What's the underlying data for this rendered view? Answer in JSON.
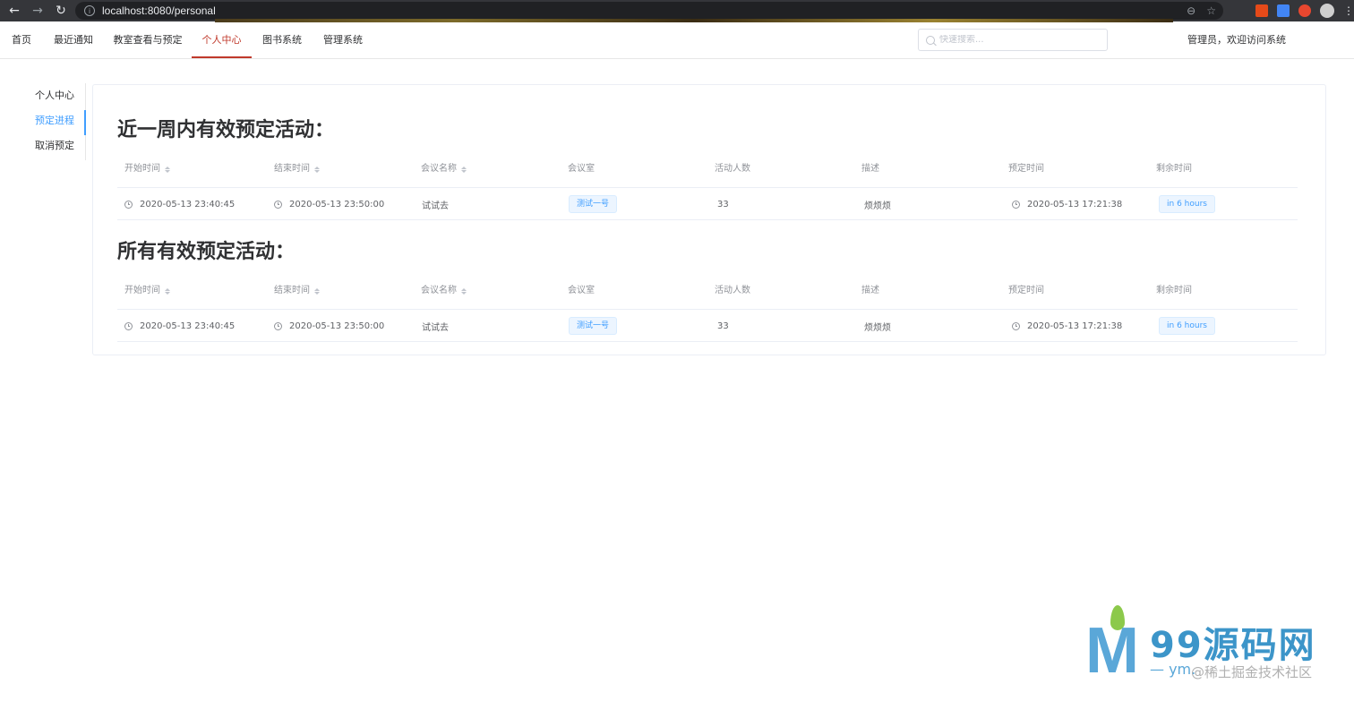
{
  "browser": {
    "url": "localhost:8080/personal",
    "back_icon": "arrow-left-icon",
    "forward_icon": "arrow-right-icon",
    "reload_icon": "reload-icon"
  },
  "top_menu": {
    "items": [
      "首页",
      "最近通知",
      "教室查看与预定",
      "个人中心",
      "图书系统",
      "管理系统"
    ],
    "active_index": 3,
    "search_placeholder": "快速搜索...",
    "welcome": "管理员，欢迎访问系统"
  },
  "side_menu": {
    "items": [
      "个人中心",
      "预定进程",
      "取消预定"
    ],
    "active_index": 1
  },
  "sections": [
    {
      "title": "近一周内有效预定活动：",
      "columns": [
        "开始时间",
        "结束时间",
        "会议名称",
        "会议室",
        "活动人数",
        "描述",
        "预定时间",
        "剩余时间"
      ],
      "rows": [
        {
          "start": "2020-05-13 23:40:45",
          "end": "2020-05-13 23:50:00",
          "name": "试试去",
          "room": "测试一号",
          "people": "33",
          "desc": "烦烦烦",
          "booked": "2020-05-13 17:21:38",
          "remaining": "in 6 hours"
        }
      ]
    },
    {
      "title": "所有有效预定活动：",
      "columns": [
        "开始时间",
        "结束时间",
        "会议名称",
        "会议室",
        "活动人数",
        "描述",
        "预定时间",
        "剩余时间"
      ],
      "rows": [
        {
          "start": "2020-05-13 23:40:45",
          "end": "2020-05-13 23:50:00",
          "name": "试试去",
          "room": "测试一号",
          "people": "33",
          "desc": "烦烦烦",
          "booked": "2020-05-13 17:21:38",
          "remaining": "in 6 hours"
        }
      ]
    }
  ],
  "watermark": {
    "brand": "99源码网",
    "sub": "— ym.",
    "credit": "@稀土掘金技术社区"
  },
  "colors": {
    "active_menu": "#c0392b",
    "accent": "#409eff"
  }
}
